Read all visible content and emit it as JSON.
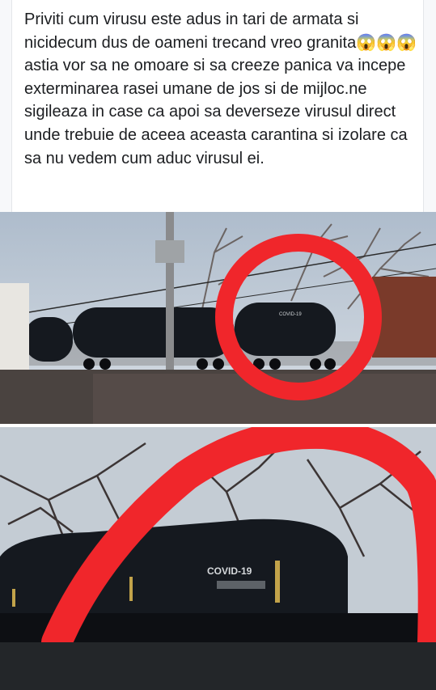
{
  "post": {
    "text": "Priviti cum virusu este adus in tari de armata si nicidecum dus de oameni trecand vreo granita😱😱😱astia vor sa ne omoare si sa creeze panica va incepe exterminarea rasei umane de jos si de mijloc.ne sigileaza in case ca apoi sa deverseze virusul direct unde trebuie de aceea aceasta carantina si izolare ca sa nu vedem cum aduc virusul ei."
  },
  "photos": {
    "top": {
      "tank_marking": "COVID-19",
      "circle_color": "#f0262b"
    },
    "bottom": {
      "tank_marking": "COVID-19",
      "circle_color": "#f0262b"
    }
  },
  "colors": {
    "tank": "#15191f",
    "sky": "#c9d4de",
    "footer": "#232629"
  }
}
